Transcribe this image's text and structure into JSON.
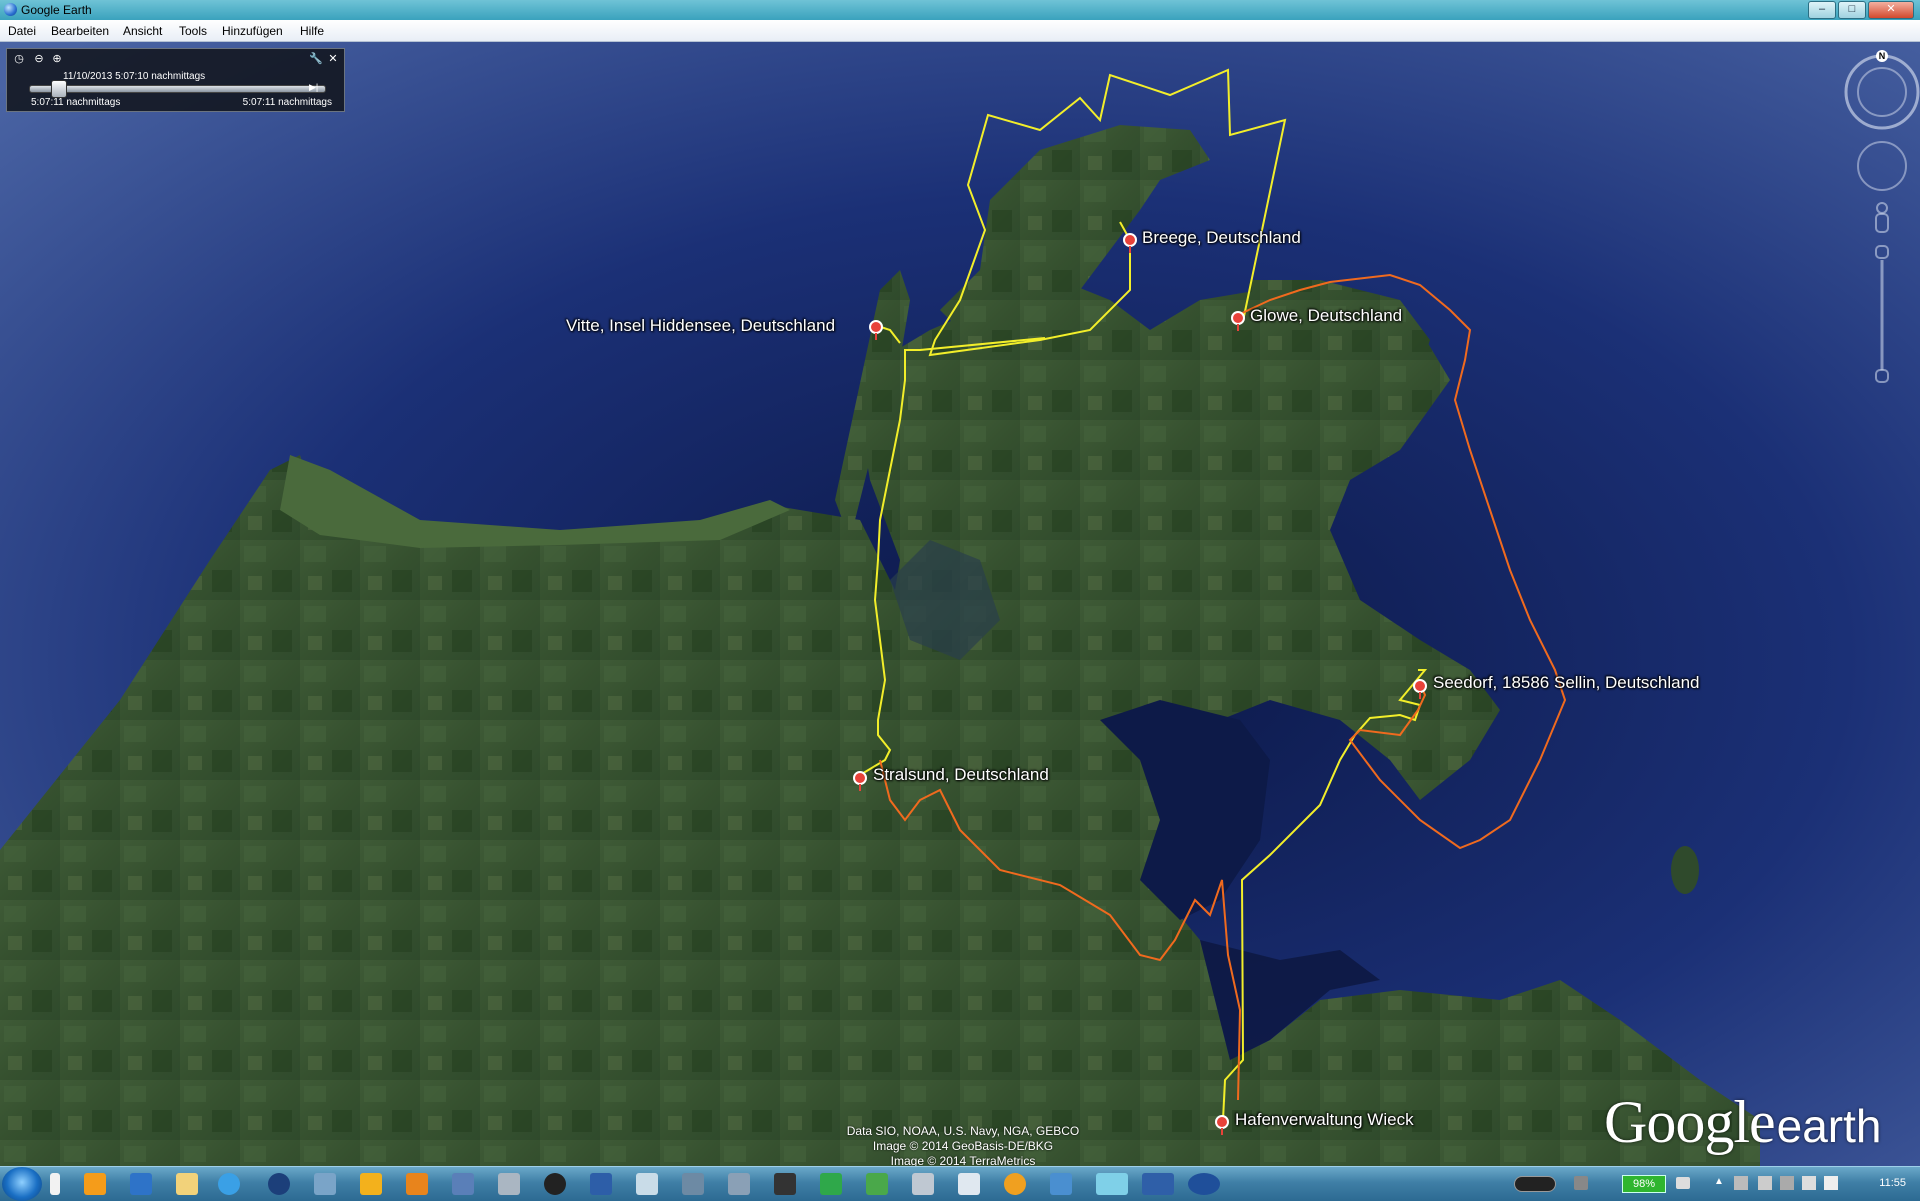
{
  "window": {
    "title": "Google Earth",
    "minimize": "–",
    "maximize": "□",
    "close": "✕"
  },
  "menu": [
    "Datei",
    "Bearbeiten",
    "Ansicht",
    "Tools",
    "Hinzufügen",
    "Hilfe"
  ],
  "time_slider": {
    "current": "11/10/2013   5:07:10 nachmittags",
    "start": "5:07:11 nachmittags",
    "end": "5:07:11 nachmittags",
    "icons": [
      "clock-icon",
      "zoom-out-icon",
      "zoom-in-icon",
      "wrench-icon",
      "close-icon"
    ]
  },
  "compass": {
    "north": "N"
  },
  "placemarks": [
    {
      "id": "vitte",
      "label": "Vitte, Insel Hiddensee, Deutschland"
    },
    {
      "id": "breege",
      "label": "Breege, Deutschland"
    },
    {
      "id": "glowe",
      "label": "Glowe, Deutschland"
    },
    {
      "id": "seedorf",
      "label": "Seedorf, 18586 Sellin, Deutschland"
    },
    {
      "id": "stralsund",
      "label": "Stralsund, Deutschland"
    },
    {
      "id": "wieck",
      "label": "Hafenverwaltung Wieck"
    }
  ],
  "routes": {
    "yellow": "#f2ee2a",
    "orange": "#f06a1e"
  },
  "copyright": [
    "Data SIO, NOAA, U.S. Navy, NGA, GEBCO",
    "Image © 2014 GeoBasis-DE/BKG",
    "Image © 2014 TerraMetrics"
  ],
  "logo": {
    "google": "Google",
    "earth": "earth"
  },
  "taskbar": {
    "battery": "98%",
    "time": "11:55"
  }
}
